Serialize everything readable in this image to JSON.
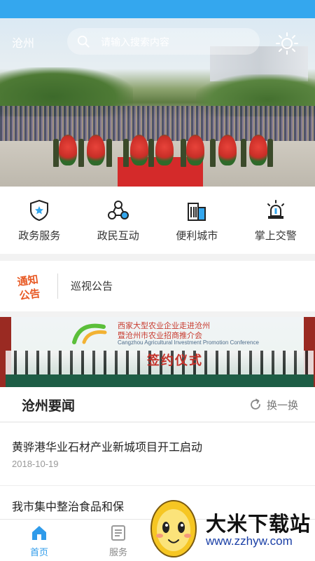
{
  "colors": {
    "status_bar": "#34a7ee",
    "accent": "#2f9bea",
    "text_primary": "#222222",
    "text_secondary": "#999999"
  },
  "header": {
    "city": "沧州",
    "search_placeholder": "请输入搜索内容",
    "weather_icon": "sun-icon"
  },
  "menu": [
    {
      "label": "政务服务",
      "icon": "shield-star-icon"
    },
    {
      "label": "政民互动",
      "icon": "people-network-icon"
    },
    {
      "label": "便利城市",
      "icon": "building-icon"
    },
    {
      "label": "掌上交警",
      "icon": "police-siren-icon"
    }
  ],
  "notice": {
    "badge_line1": "通知",
    "badge_line2": "公告",
    "text": "巡视公告"
  },
  "banner": {
    "line1": "西家大型农业企业走进沧州",
    "line2": "暨沧州市农业招商推介会",
    "line3": "Cangzhou Agricultural Investment Promotion Conference",
    "sign": "签约仪式"
  },
  "news": {
    "section_title": "沧州要闻",
    "refresh_label": "换一换",
    "items": [
      {
        "headline": "黄骅港华业石材产业新城项目开工启动",
        "date": "2018-10-19"
      },
      {
        "headline": "我市集中整治食品和保",
        "date": ""
      }
    ]
  },
  "tabbar": {
    "items": [
      {
        "label": "首页",
        "icon": "home-icon",
        "active": true
      },
      {
        "label": "服务",
        "icon": "service-icon",
        "active": false
      }
    ]
  },
  "watermark": {
    "title": "大米下载站",
    "url": "www.zzhyw.com"
  }
}
